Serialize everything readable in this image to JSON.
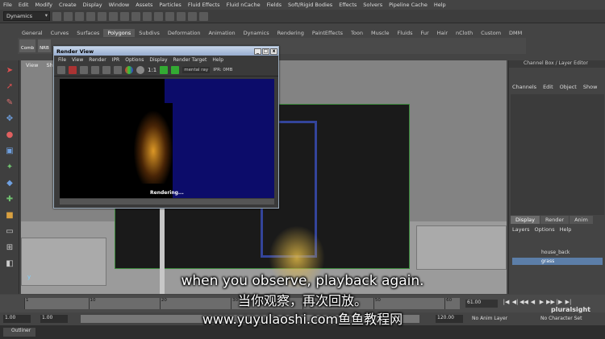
{
  "menubar": [
    "File",
    "Edit",
    "Modify",
    "Create",
    "Display",
    "Window",
    "Assets",
    "Particles",
    "Fluid Effects",
    "Fluid nCache",
    "Fields",
    "Soft/Rigid Bodies",
    "Effects",
    "Solvers",
    "Pipeline Cache",
    "Help"
  ],
  "toolbar": {
    "mode": "Dynamics"
  },
  "shelf": {
    "tabs": [
      "General",
      "Curves",
      "Surfaces",
      "Polygons",
      "Subdivs",
      "Deformation",
      "Animation",
      "Dynamics",
      "Rendering",
      "PaintEffects",
      "Toon",
      "Muscle",
      "Fluids",
      "Fur",
      "Hair",
      "nCloth",
      "Custom",
      "DMM"
    ],
    "active_tab": "Polygons",
    "icons": [
      "Comb",
      "NRB"
    ]
  },
  "viewport": {
    "menu": [
      "View",
      "Sha"
    ],
    "axis": "y"
  },
  "render_view": {
    "title": "Render View",
    "window_controls": [
      "_",
      "□",
      "x"
    ],
    "menu": [
      "File",
      "View",
      "Render",
      "IPR",
      "Options",
      "Display",
      "Render Target",
      "Help"
    ],
    "ratio": "1:1",
    "renderer": "mental ray",
    "ipr_memory": "IPR: 0MB",
    "status": "Rendering..."
  },
  "channel_box": {
    "title": "Channel Box / Layer Editor",
    "menu": [
      "Channels",
      "Edit",
      "Object",
      "Show"
    ],
    "layer_tabs": [
      "Display",
      "Render",
      "Anim"
    ],
    "active_layer_tab": "Display",
    "layer_menu": [
      "Layers",
      "Options",
      "Help"
    ],
    "layers": [
      {
        "name": "house_back",
        "selected": false
      },
      {
        "name": "grass",
        "selected": true
      }
    ]
  },
  "timeline": {
    "ticks": [
      "1",
      "10",
      "20",
      "30",
      "40",
      "50",
      "60"
    ],
    "current_frame": "61.00",
    "transport": [
      "|◀",
      "◀|",
      "◀◀",
      "◀",
      "▶",
      "▶▶",
      "|▶",
      "▶|"
    ]
  },
  "range": {
    "start": "1.00",
    "playback_start": "1.00",
    "playback_end": "120.00",
    "end": "120.00",
    "anim_layer": "No Anim Layer",
    "character_set": "No Character Set"
  },
  "taskbar": {
    "item": "Outliner"
  },
  "watermark": "pluralsight",
  "subtitles": {
    "line1": "when you observe, playback again.",
    "line2": "当你观察，再次回放。",
    "line3": "www.yuyulaoshi.com鱼鱼教程网"
  },
  "colors": {
    "accent": "#5c7ea8",
    "render_bg": "#0c0c6a",
    "fire": "#e8a028"
  }
}
